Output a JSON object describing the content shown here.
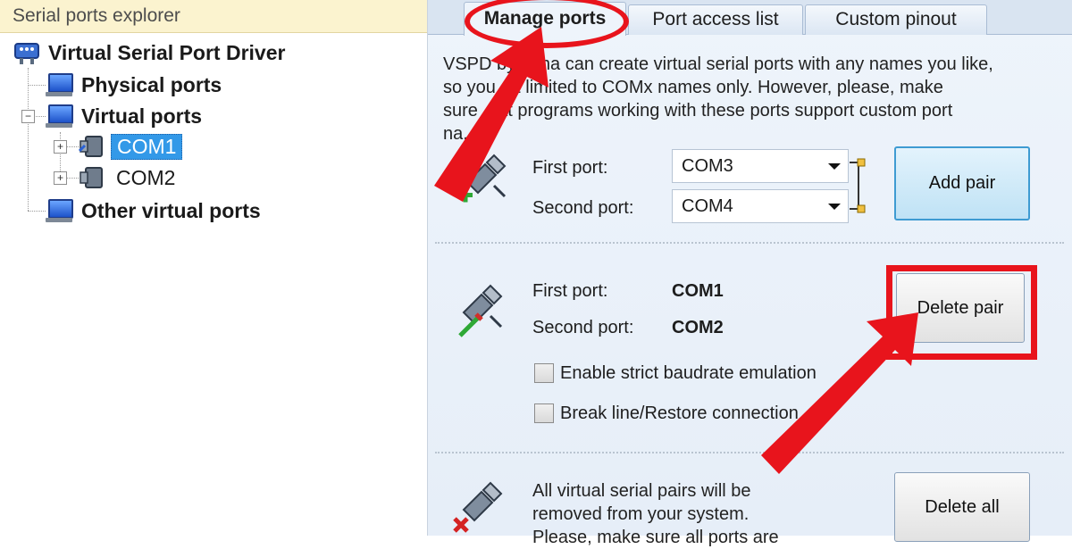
{
  "explorer": {
    "title": "Serial ports explorer",
    "tree": {
      "root": "Virtual Serial Port Driver",
      "physical": "Physical ports",
      "virtual": "Virtual ports",
      "com1": "COM1",
      "com2": "COM2",
      "other": "Other virtual ports"
    }
  },
  "tabs": {
    "manage": "Manage ports",
    "access": "Port access list",
    "pinout": "Custom pinout",
    "active": "manage"
  },
  "add_section": {
    "description_lines": [
      "VSPD by ...ma can create virtual serial ports with any names you like,",
      "so you ...t limited to COMx names only. However, please, make",
      "sure ...at programs working with these ports support custom port",
      "na...s."
    ],
    "first_label": "First port:",
    "first_value": "COM3",
    "second_label": "Second port:",
    "second_value": "COM4",
    "button": "Add pair"
  },
  "delete_section": {
    "first_label": "First port:",
    "first_value": "COM1",
    "second_label": "Second port:",
    "second_value": "COM2",
    "button": "Delete pair",
    "strict_baud": {
      "label": "Enable strict baudrate emulation",
      "checked": false
    },
    "break_line": {
      "label": "Break line/Restore connection",
      "checked": false
    }
  },
  "delete_all_section": {
    "description_lines": [
      "All virtual serial pairs will be",
      "removed from your system.",
      "Please, make sure all ports are"
    ],
    "button": "Delete all"
  },
  "colors": {
    "annotation_red": "#e8141c",
    "selection_blue": "#3399e8",
    "panel_bg": "#eef4fb",
    "header_yellow": "#fbf3cf"
  }
}
